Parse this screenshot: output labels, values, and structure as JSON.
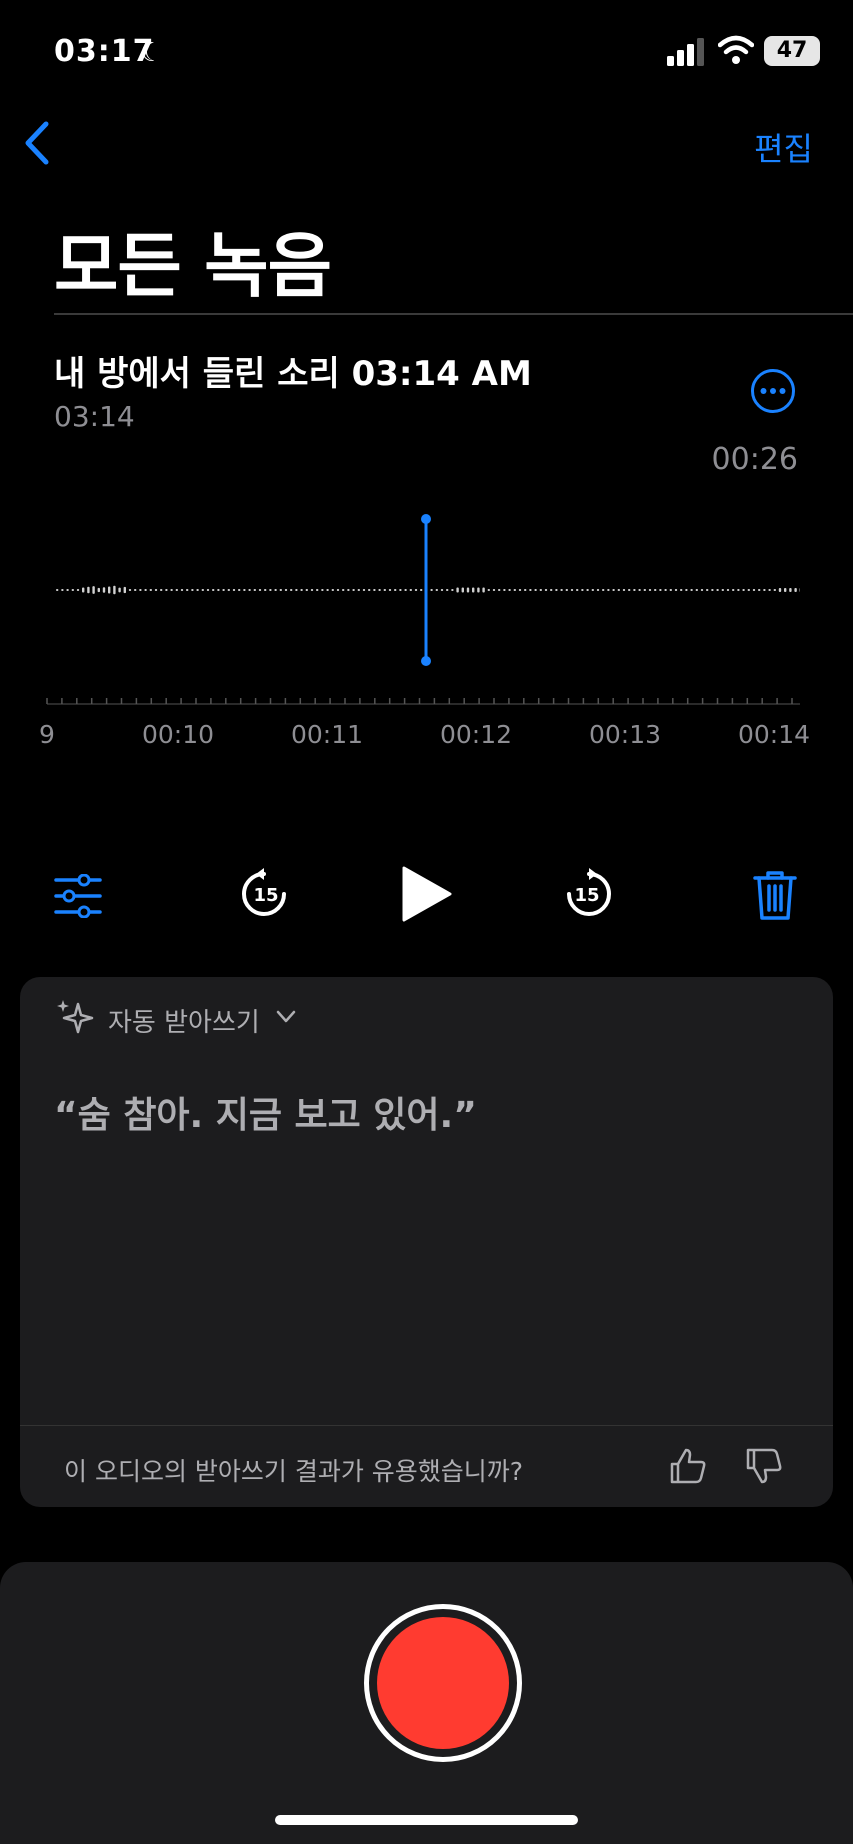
{
  "status_bar": {
    "time": "03:17",
    "battery": "47"
  },
  "nav": {
    "edit_label": "편집"
  },
  "page_title": "모든 녹음",
  "recording": {
    "title": "내 방에서 들린 소리 03:14 AM",
    "time": "03:14",
    "duration": "00:26"
  },
  "timeline": {
    "labels": [
      "9",
      "00:10",
      "00:11",
      "00:12",
      "00:13",
      "00:14"
    ]
  },
  "transcript": {
    "header": "자동 받아쓰기",
    "quote": "“숨 참아. 지금 보고 있어.”",
    "feedback_question": "이 오디오의 받아쓰기 결과가 유용했습니까?"
  },
  "controls": {
    "skip_seconds": "15"
  },
  "colors": {
    "accent": "#1a82ff",
    "record": "#ff3b30",
    "card": "#1c1c1e"
  }
}
